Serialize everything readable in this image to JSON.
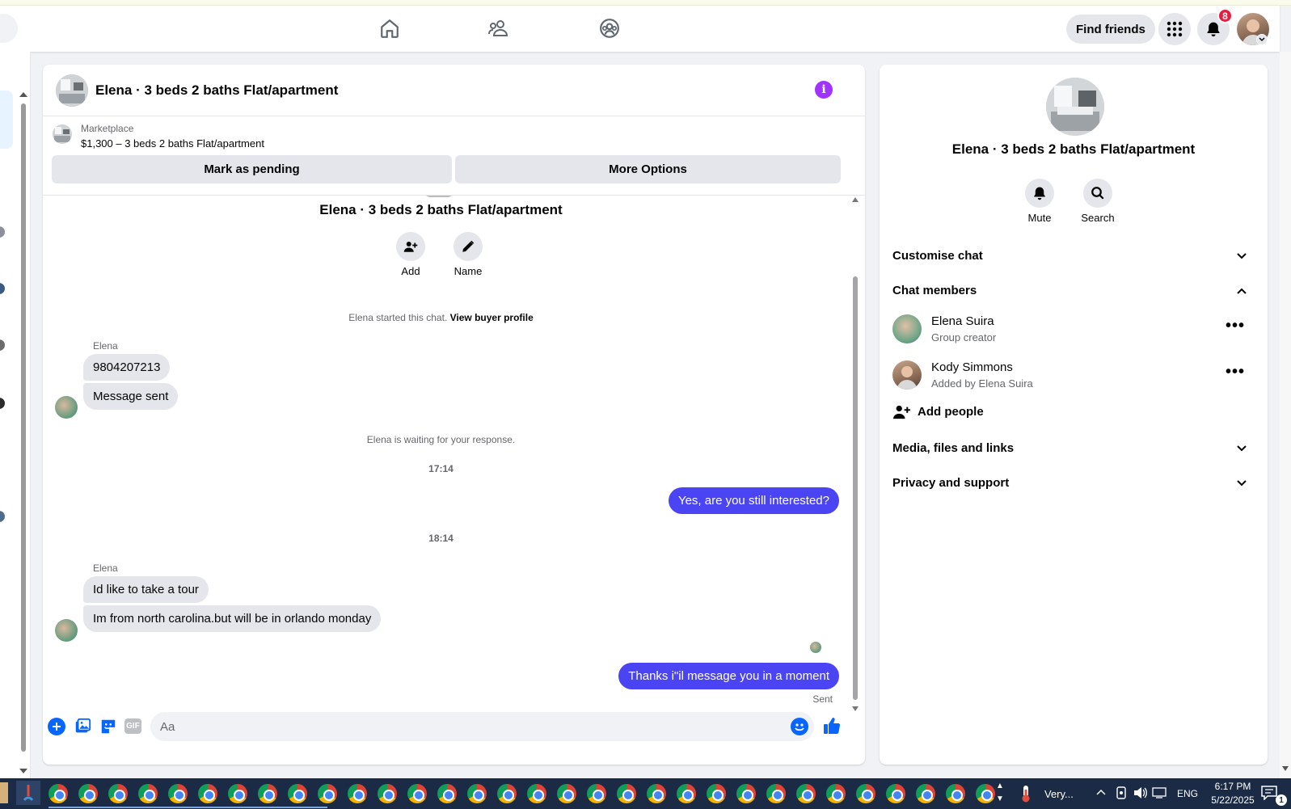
{
  "nav": {
    "find_friends": "Find friends",
    "notif_count": "8"
  },
  "chat": {
    "title": "Elena · 3 beds 2 baths Flat/apartment",
    "marketplace_label": "Marketplace",
    "listing_line": "$1,300 – 3 beds 2 baths Flat/apartment",
    "mark_pending": "Mark as pending",
    "more_options": "More Options",
    "intro_title": "Elena · 3 beds 2 baths Flat/apartment",
    "add_label": "Add",
    "name_label": "Name",
    "started_text": "Elena started this chat.",
    "view_buyer_profile": "View buyer profile",
    "sender1": "Elena",
    "msg1": "9804207213",
    "msg2": "Message sent",
    "waiting_text": "Elena is waiting for your response.",
    "time1": "17:14",
    "out1": "Yes, are you still interested?",
    "time2": "18:14",
    "sender2": "Elena",
    "msg3": "Id like to take a tour",
    "msg4": "Im from north carolina.but will be in orlando monday",
    "out2": "Thanks i\"il message you in a moment",
    "sent_status": "Sent",
    "composer_placeholder": "Aa"
  },
  "info": {
    "title": "Elena · 3 beds 2 baths Flat/apartment",
    "mute": "Mute",
    "search": "Search",
    "customise_chat": "Customise chat",
    "chat_members": "Chat members",
    "members": [
      {
        "name": "Elena Suira",
        "sub": "Group creator"
      },
      {
        "name": "Kody Simmons",
        "sub": "Added by Elena Suira"
      }
    ],
    "add_people": "Add people",
    "media_files": "Media, files and links",
    "privacy_support": "Privacy and support"
  },
  "taskbar": {
    "weather": "Very...",
    "lang": "ENG",
    "time": "6:17 PM",
    "date": "5/22/2025",
    "notif": "1"
  },
  "colors": {
    "accent": "#4a44f2",
    "fb_blue": "#0866ff",
    "info_purple": "#a033ff",
    "badge_red": "#e41e3f"
  }
}
